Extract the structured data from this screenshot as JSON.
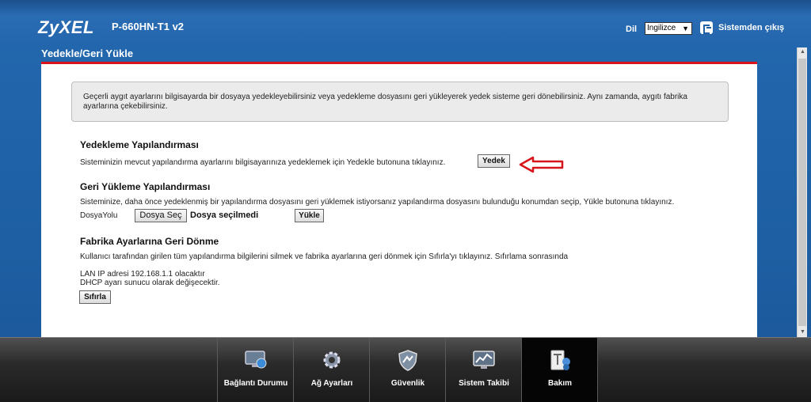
{
  "header": {
    "brand": "ZyXEL",
    "model": "P-660HN-T1 v2",
    "language_label": "Dil",
    "language_value": "Ingilizce",
    "logout_label": "Sistemden çıkış"
  },
  "page_title": "Yedekle/Geri Yükle",
  "info_text": "Geçerli aygıt ayarlarını bilgisayarda bir dosyaya yedekleyebilirsiniz veya yedekleme dosyasını geri yükleyerek yedek sisteme geri dönebilirsiniz. Aynı zamanda, aygıtı fabrika ayarlarına çekebilirsiniz.",
  "backup": {
    "title": "Yedekleme Yapılandırması",
    "text": "Sisteminizin mevcut yapılandırma ayarlarını bilgisayarınıza yedeklemek için Yedekle butonuna tıklayınız.",
    "button": "Yedek"
  },
  "restore": {
    "title": "Geri Yükleme Yapılandırması",
    "text": "Sisteminize, daha önce yedeklenmiş bir yapılandırma dosyasını geri yüklemek istiyorsanız yapılandırma dosyasını bulunduğu konumdan seçip, Yükle butonuna tıklayınız.",
    "file_label": "DosyaYolu",
    "choose_button": "Dosya Seç",
    "no_file": "Dosya seçilmedi",
    "upload_button": "Yükle"
  },
  "factory": {
    "title": "Fabrika Ayarlarına Geri Dönme",
    "text": "Kullanıcı tarafından girilen tüm yapılandırma bilgilerini silmek ve fabrika ayarlarına geri dönmek için Sıfırla'yı tıklayınız. Sıfırlama sonrasında",
    "line1": "LAN IP adresi 192.168.1.1 olacaktır",
    "line2": "DHCP ayarı sunucu olarak değişecektir.",
    "button": "Sıfırla"
  },
  "nav": [
    {
      "label": "Bağlantı Durumu",
      "icon": "monitor-globe-icon"
    },
    {
      "label": "Ağ Ayarları",
      "icon": "gear-icon"
    },
    {
      "label": "Güvenlik",
      "icon": "shield-icon"
    },
    {
      "label": "Sistem Takibi",
      "icon": "chart-monitor-icon"
    },
    {
      "label": "Bakım",
      "icon": "maintenance-icon",
      "active": true
    }
  ],
  "colors": {
    "accent_red": "#d8141b",
    "header_blue": "#1e5fa3"
  }
}
